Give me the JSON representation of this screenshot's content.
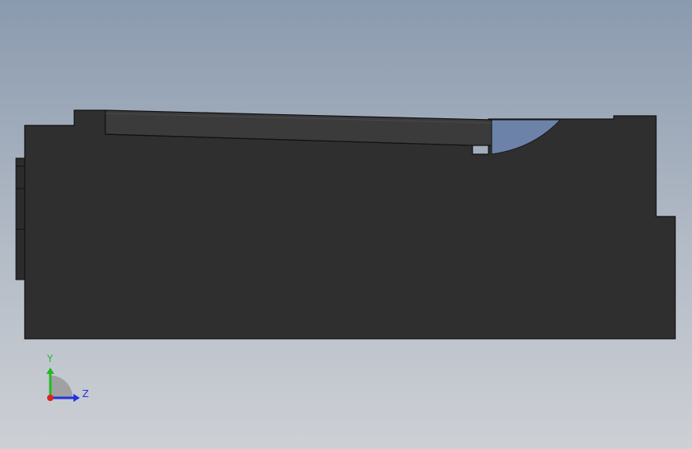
{
  "viewport": {
    "background_top": "#8a9aae",
    "background_bottom": "#cdd0d5"
  },
  "model": {
    "body_color": "#2f2f2f",
    "rail_color": "#3c3c3c",
    "outline_color": "#111111",
    "highlight_color": "#6c82a8"
  },
  "triad": {
    "y_label": "Y",
    "z_label": "Z",
    "y_color": "#22bb22",
    "z_color": "#2233dd",
    "x_color": "#dd2222"
  }
}
